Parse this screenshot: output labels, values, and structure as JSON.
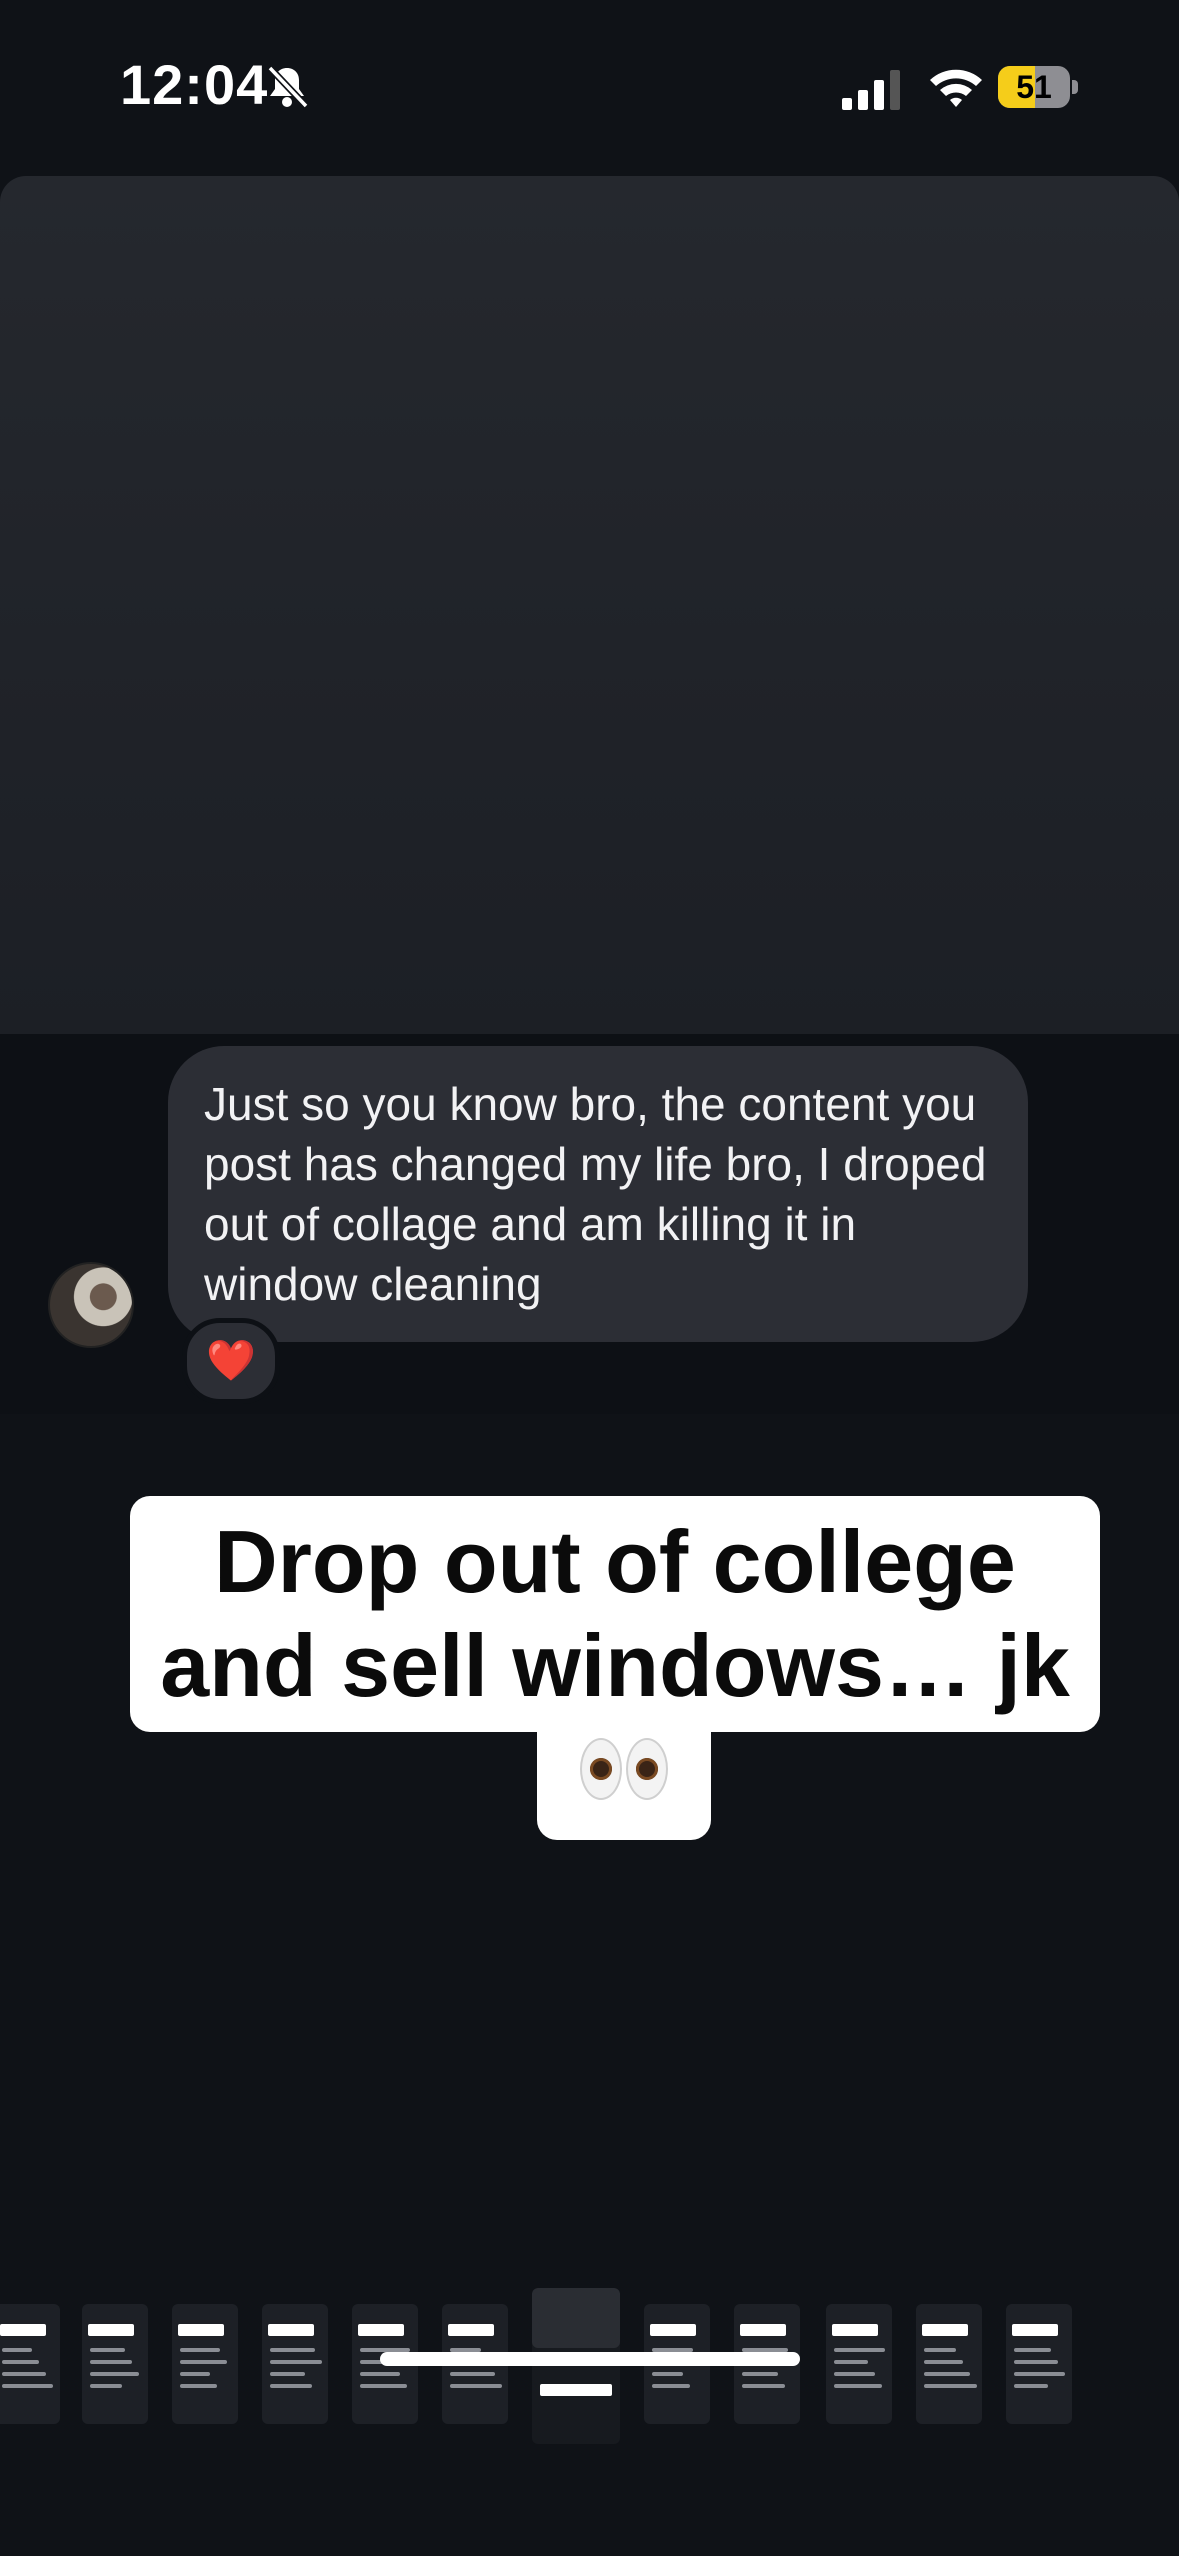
{
  "status_bar": {
    "time": "12:04",
    "battery_level": "51",
    "battery_fraction": 0.51,
    "icons": [
      "bell-slash-icon",
      "cellular-signal-icon",
      "wifi-icon",
      "battery-icon"
    ]
  },
  "message": {
    "text": "Just so you know bro, the content you post has changed my life bro, I droped out of collage and am killing it in window cleaning",
    "reaction": "❤️"
  },
  "caption": {
    "main": "Drop out of college and sell windows… jk",
    "emoji": "👀"
  },
  "thumbnail_strip": {
    "count": 12,
    "active_index": 6,
    "labels": [
      "W I S I",
      "",
      "",
      "",
      "",
      "",
      "Drop out of college and sell windows… jk",
      "Pro day",
      "Content that was to get out results...",
      "",
      "",
      ""
    ]
  },
  "colors": {
    "background": "#0f1217",
    "bubble": "#2c2e35",
    "battery_accent": "#f5cd1a",
    "heart": "#ff2d3a"
  }
}
